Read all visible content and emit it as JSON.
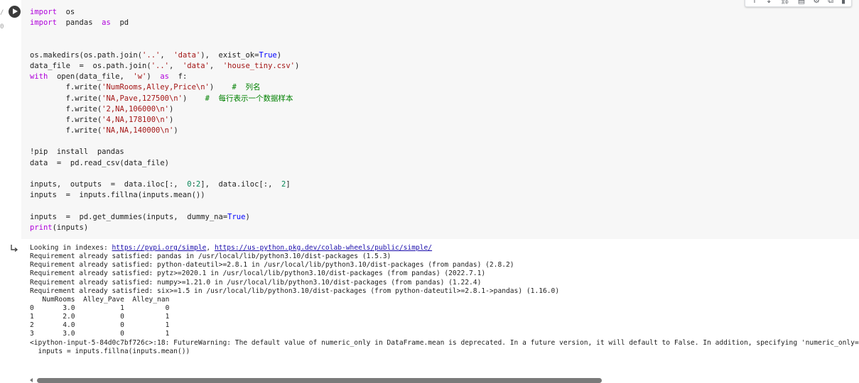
{
  "toolbar": {
    "icons": [
      "move-up",
      "move-down",
      "link",
      "comment",
      "settings",
      "mirror",
      "delete"
    ],
    "glyphs": [
      "↑",
      "↓",
      "⛓",
      "▤",
      "⚙",
      "⧉",
      "▮"
    ]
  },
  "gutter": {
    "marks": [
      "/",
      "0"
    ]
  },
  "code": [
    [
      {
        "t": "import",
        "c": "kw"
      },
      {
        "t": "  os"
      }
    ],
    [
      {
        "t": "import",
        "c": "kw"
      },
      {
        "t": "  pandas  "
      },
      {
        "t": "as",
        "c": "kw"
      },
      {
        "t": "  pd"
      }
    ],
    [],
    [],
    [
      {
        "t": "os.makedirs(os.path.join("
      },
      {
        "t": "'..'",
        "c": "str"
      },
      {
        "t": ",  "
      },
      {
        "t": "'data'",
        "c": "str"
      },
      {
        "t": "),  exist_ok="
      },
      {
        "t": "True",
        "c": "bool"
      },
      {
        "t": ")"
      }
    ],
    [
      {
        "t": "data_file  =  os.path.join("
      },
      {
        "t": "'..'",
        "c": "str"
      },
      {
        "t": ",  "
      },
      {
        "t": "'data'",
        "c": "str"
      },
      {
        "t": ",  "
      },
      {
        "t": "'house_tiny.csv'",
        "c": "str"
      },
      {
        "t": ")"
      }
    ],
    [
      {
        "t": "with",
        "c": "kw"
      },
      {
        "t": "  open(data_file,  "
      },
      {
        "t": "'w'",
        "c": "str"
      },
      {
        "t": ")  "
      },
      {
        "t": "as",
        "c": "kw"
      },
      {
        "t": "  f:"
      }
    ],
    [
      {
        "t": "        f.write("
      },
      {
        "t": "'NumRooms,Alley,Price\\n'",
        "c": "str"
      },
      {
        "t": ")    "
      },
      {
        "t": "#  列名",
        "c": "cmt"
      }
    ],
    [
      {
        "t": "        f.write("
      },
      {
        "t": "'NA,Pave,127500\\n'",
        "c": "str"
      },
      {
        "t": ")    "
      },
      {
        "t": "#  每行表示一个数据样本",
        "c": "cmt"
      }
    ],
    [
      {
        "t": "        f.write("
      },
      {
        "t": "'2,NA,106000\\n'",
        "c": "str"
      },
      {
        "t": ")"
      }
    ],
    [
      {
        "t": "        f.write("
      },
      {
        "t": "'4,NA,178100\\n'",
        "c": "str"
      },
      {
        "t": ")"
      }
    ],
    [
      {
        "t": "        f.write("
      },
      {
        "t": "'NA,NA,140000\\n'",
        "c": "str"
      },
      {
        "t": ")"
      }
    ],
    [],
    [
      {
        "t": "!pip  install  pandas"
      }
    ],
    [
      {
        "t": "data  =  pd.read_csv(data_file)"
      }
    ],
    [],
    [
      {
        "t": "inputs,  outputs  =  data.iloc[:,  "
      },
      {
        "t": "0",
        "c": "num"
      },
      {
        "t": ":"
      },
      {
        "t": "2",
        "c": "num"
      },
      {
        "t": "],  data.iloc[:,  "
      },
      {
        "t": "2",
        "c": "num"
      },
      {
        "t": "]"
      }
    ],
    [
      {
        "t": "inputs  =  inputs.fillna(inputs.mean())"
      }
    ],
    [],
    [
      {
        "t": "inputs  =  pd.get_dummies(inputs,  dummy_na="
      },
      {
        "t": "True",
        "c": "bool"
      },
      {
        "t": ")"
      }
    ],
    [
      {
        "t": "print",
        "c": "kw"
      },
      {
        "t": "(inputs)"
      }
    ]
  ],
  "output": [
    [
      {
        "t": "Looking in indexes: "
      },
      {
        "t": "https://pypi.org/simple",
        "c": "link"
      },
      {
        "t": ", "
      },
      {
        "t": "https://us-python.pkg.dev/colab-wheels/public/simple/",
        "c": "link"
      }
    ],
    [
      {
        "t": "Requirement already satisfied: pandas in /usr/local/lib/python3.10/dist-packages (1.5.3)"
      }
    ],
    [
      {
        "t": "Requirement already satisfied: python-dateutil>=2.8.1 in /usr/local/lib/python3.10/dist-packages (from pandas) (2.8.2)"
      }
    ],
    [
      {
        "t": "Requirement already satisfied: pytz>=2020.1 in /usr/local/lib/python3.10/dist-packages (from pandas) (2022.7.1)"
      }
    ],
    [
      {
        "t": "Requirement already satisfied: numpy>=1.21.0 in /usr/local/lib/python3.10/dist-packages (from pandas) (1.22.4)"
      }
    ],
    [
      {
        "t": "Requirement already satisfied: six>=1.5 in /usr/local/lib/python3.10/dist-packages (from python-dateutil>=2.8.1->pandas) (1.16.0)"
      }
    ],
    [
      {
        "t": "   NumRooms  Alley_Pave  Alley_nan"
      }
    ],
    [
      {
        "t": "0       3.0           1          0"
      }
    ],
    [
      {
        "t": "1       2.0           0          1"
      }
    ],
    [
      {
        "t": "2       4.0           0          1"
      }
    ],
    [
      {
        "t": "3       3.0           0          1"
      }
    ],
    [
      {
        "t": "<ipython-input-5-84d0c7bf726c>:18: FutureWarning: The default value of numeric_only in DataFrame.mean is deprecated. In a future version, it will default to False. In addition, specifying 'numeric_only=None'"
      }
    ],
    [
      {
        "t": "  inputs = inputs.fillna(inputs.mean())"
      }
    ]
  ],
  "colors": {
    "keyword": "#af00db",
    "string": "#a31515",
    "number": "#098658",
    "boolean": "#0000ff",
    "comment": "#008000",
    "link": "#1a0dab",
    "code_background": "#f7f7f7"
  }
}
